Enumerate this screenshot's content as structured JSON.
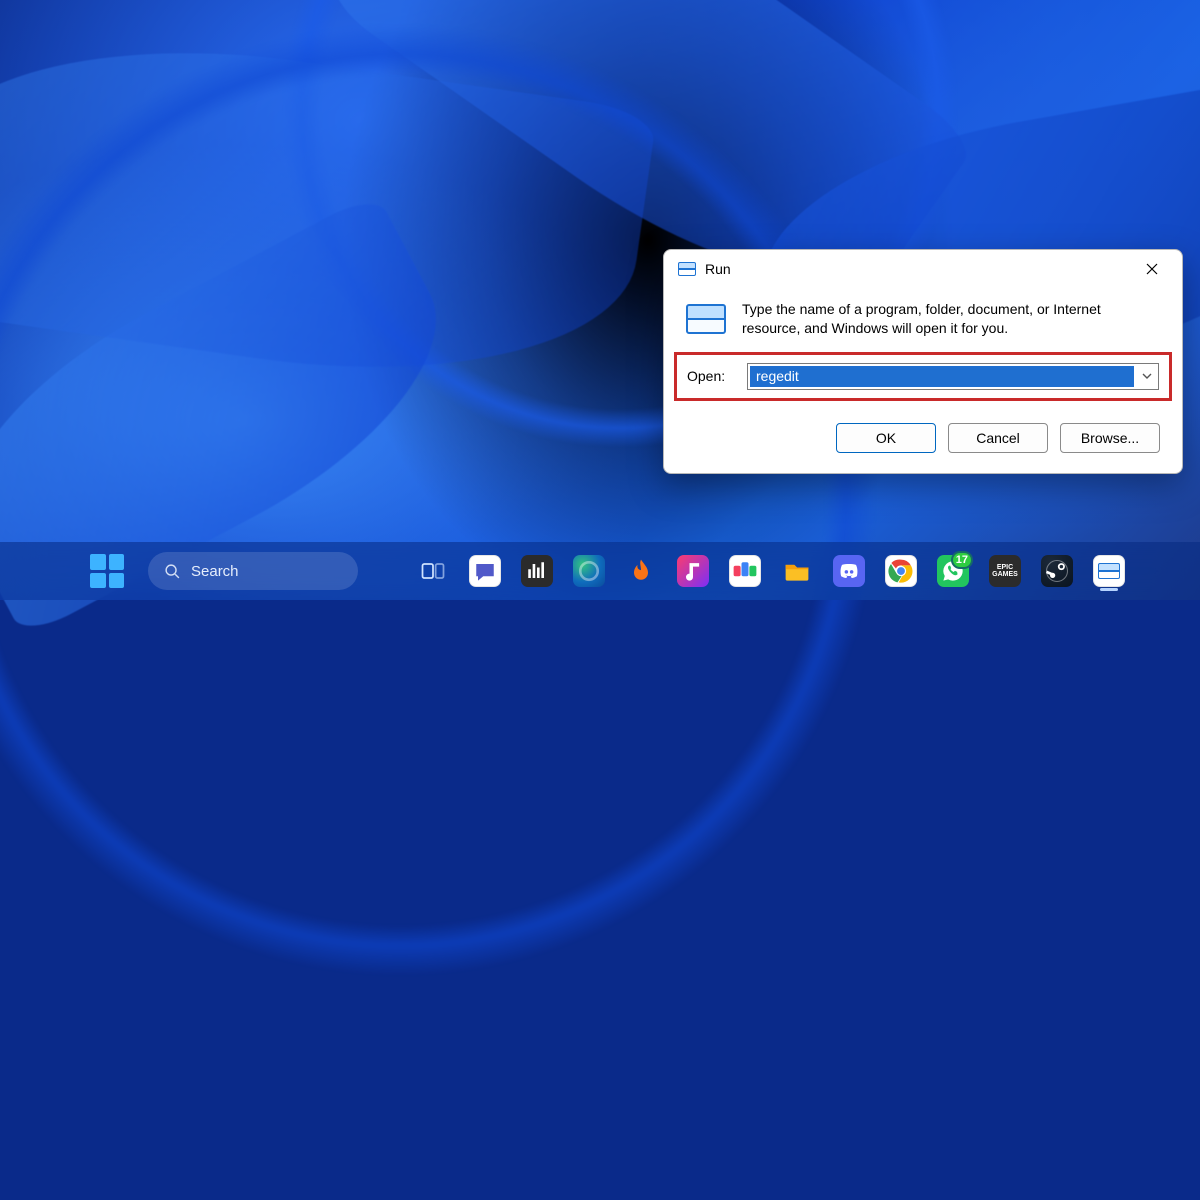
{
  "run_dialog": {
    "title": "Run",
    "instruction": "Type the name of a program, folder, document, or Internet resource, and Windows will open it for you.",
    "open_label": "Open:",
    "input_value": "regedit",
    "buttons": {
      "ok": "OK",
      "cancel": "Cancel",
      "browse": "Browse..."
    }
  },
  "taskbar": {
    "search_placeholder": "Search",
    "whatsapp_badge": "17",
    "apps": [
      {
        "name": "task-view"
      },
      {
        "name": "chat"
      },
      {
        "name": "equalizer"
      },
      {
        "name": "edge"
      },
      {
        "name": "flame"
      },
      {
        "name": "music"
      },
      {
        "name": "gallery"
      },
      {
        "name": "file-explorer"
      },
      {
        "name": "discord"
      },
      {
        "name": "chrome"
      },
      {
        "name": "whatsapp"
      },
      {
        "name": "epic-games"
      },
      {
        "name": "steam"
      },
      {
        "name": "run"
      }
    ]
  }
}
